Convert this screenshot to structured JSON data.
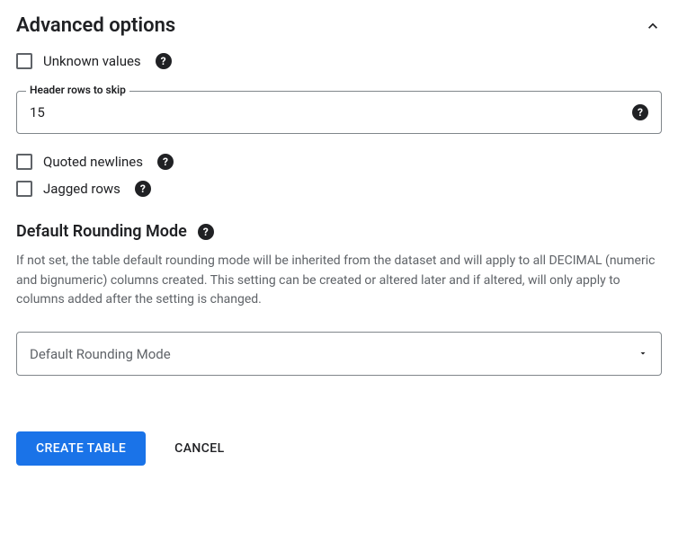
{
  "section": {
    "title": "Advanced options"
  },
  "options": {
    "unknown_values_label": "Unknown values",
    "quoted_newlines_label": "Quoted newlines",
    "jagged_rows_label": "Jagged rows"
  },
  "header_rows_field": {
    "label": "Header rows to skip",
    "value": "15"
  },
  "rounding": {
    "title": "Default Rounding Mode",
    "description": "If not set, the table default rounding mode will be inherited from the dataset and will apply to all DECIMAL (numeric and bignumeric) columns created. This setting can be created or altered later and if altered, will only apply to columns added after the setting is changed.",
    "selected": "Default Rounding Mode"
  },
  "actions": {
    "create": "CREATE TABLE",
    "cancel": "CANCEL"
  }
}
